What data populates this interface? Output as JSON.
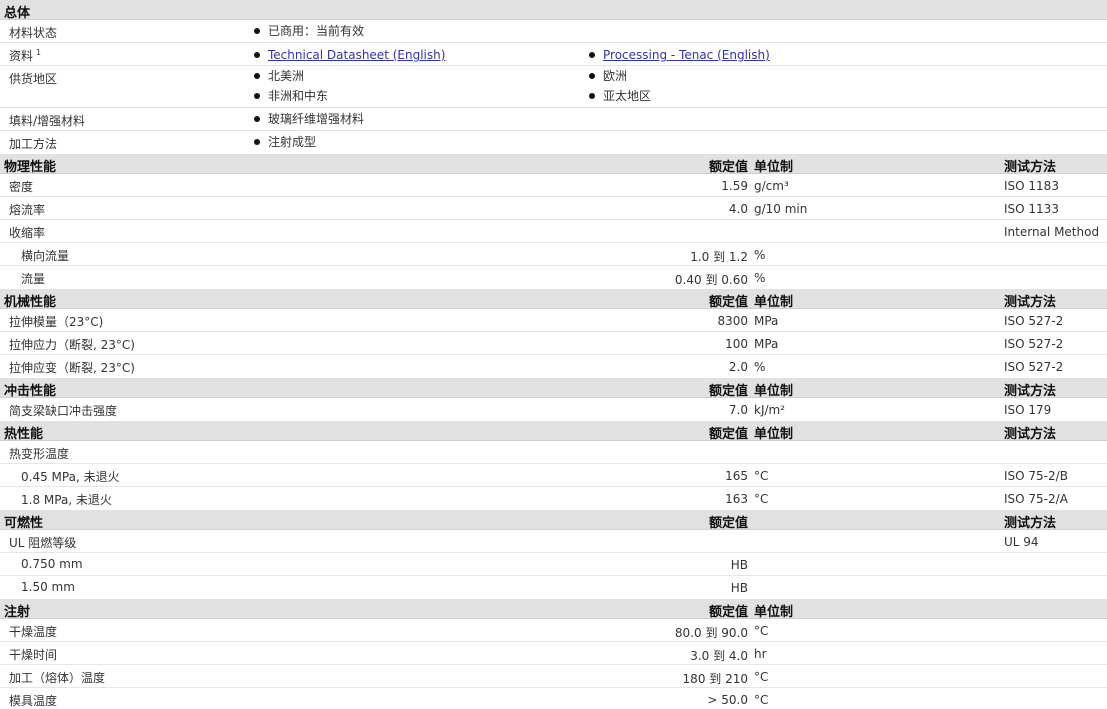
{
  "general": {
    "title": "总体",
    "material_status_label": "材料状态",
    "material_status": "已商用：当前有效",
    "docs_label": "资料",
    "docs_sup": "1",
    "doc_link_1": "Technical Datasheet (English)",
    "doc_link_2": "Processing - Tenac (English)",
    "supply_label": "供货地区",
    "supply_regions": [
      "北美洲",
      "欧洲",
      "非洲和中东",
      "亚太地区"
    ],
    "filler_label": "填料/增强材料",
    "filler": "玻璃纤维增强材料",
    "process_label": "加工方法",
    "process": "注射成型"
  },
  "columns": {
    "nominal": "额定值",
    "unit": "单位制",
    "test": "测试方法"
  },
  "physical": {
    "title": "物理性能",
    "rows": [
      {
        "label": "密度",
        "value": "1.59",
        "unit": "g/cm³",
        "test": "ISO 1183"
      },
      {
        "label": "熔流率",
        "value": "4.0",
        "unit": "g/10 min",
        "test": "ISO 1133"
      },
      {
        "label": "收缩率",
        "value": "",
        "unit": "",
        "test": "Internal Method"
      },
      {
        "label": "横向流量",
        "value": "1.0 到  1.2",
        "unit": "%",
        "test": ""
      },
      {
        "label": "流量",
        "value": "0.40 到  0.60",
        "unit": "%",
        "test": ""
      }
    ]
  },
  "mechanical": {
    "title": "机械性能",
    "rows": [
      {
        "label": "拉伸模量（23°C)",
        "value": "8300",
        "unit": "MPa",
        "test": "ISO 527-2"
      },
      {
        "label": "拉伸应力（断裂, 23°C)",
        "value": "100",
        "unit": "MPa",
        "test": "ISO 527-2"
      },
      {
        "label": "拉伸应变（断裂, 23°C)",
        "value": "2.0",
        "unit": "%",
        "test": "ISO 527-2"
      }
    ]
  },
  "impact": {
    "title": "冲击性能",
    "rows": [
      {
        "label": "简支梁缺口冲击强度",
        "value": "7.0",
        "unit": "kJ/m²",
        "test": "ISO 179"
      }
    ]
  },
  "thermal": {
    "title": "热性能",
    "rows": [
      {
        "label": "热变形温度",
        "value": "",
        "unit": "",
        "test": ""
      },
      {
        "label": "0.45 MPa, 未退火",
        "value": "165",
        "unit": "°C",
        "test": "ISO 75-2/B"
      },
      {
        "label": "1.8 MPa, 未退火",
        "value": "163",
        "unit": "°C",
        "test": "ISO 75-2/A"
      }
    ]
  },
  "flammability": {
    "title": "可燃性",
    "rows": [
      {
        "label": "UL 阻燃等级",
        "value": "",
        "unit": "",
        "test": "UL 94"
      },
      {
        "label": "0.750 mm",
        "value": "HB",
        "unit": "",
        "test": ""
      },
      {
        "label": "1.50 mm",
        "value": "HB",
        "unit": "",
        "test": ""
      }
    ]
  },
  "injection": {
    "title": "注射",
    "rows": [
      {
        "label": "干燥温度",
        "value": "80.0 到  90.0",
        "unit": "°C",
        "test": ""
      },
      {
        "label": "干燥时间",
        "value": "3.0 到  4.0",
        "unit": "hr",
        "test": ""
      },
      {
        "label": "加工（熔体）温度",
        "value": "180 到  210",
        "unit": "°C",
        "test": ""
      },
      {
        "label": "模具温度",
        "value": "> 50.0",
        "unit": "°C",
        "test": ""
      }
    ]
  }
}
